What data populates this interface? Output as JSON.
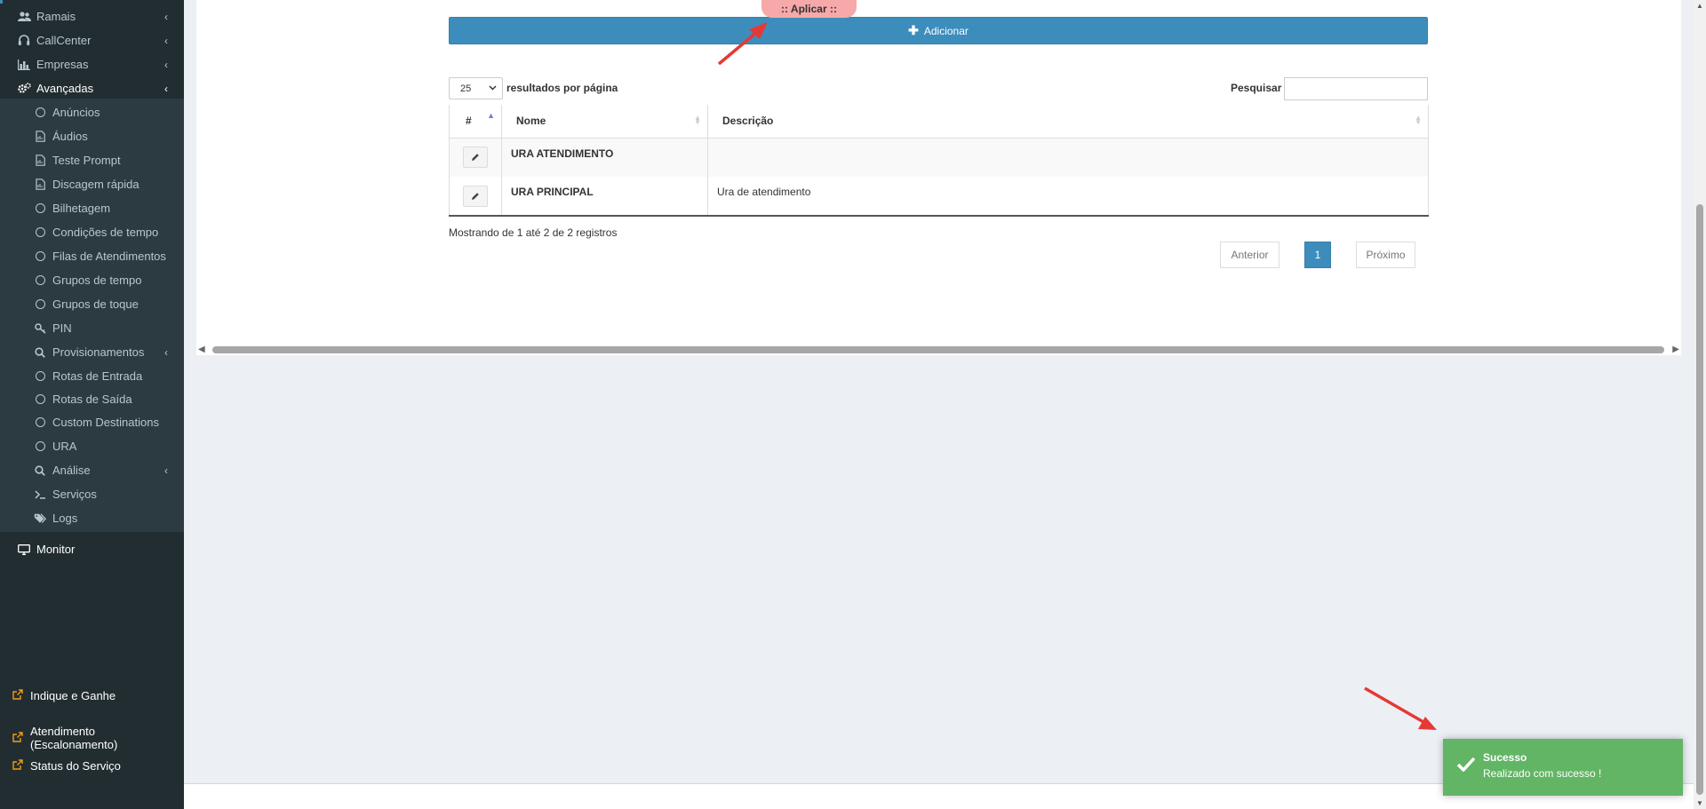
{
  "sidebar": {
    "top_items": [
      {
        "label": "Ramais",
        "icon": "users-icon",
        "chevron": "‹"
      },
      {
        "label": "CallCenter",
        "icon": "headset-icon",
        "chevron": "‹"
      },
      {
        "label": "Empresas",
        "icon": "bar-chart-icon",
        "chevron": "‹"
      },
      {
        "label": "Avançadas",
        "icon": "cogs-icon",
        "chevron": "‹"
      }
    ],
    "sub_items": [
      {
        "label": "Anúncios",
        "icon": "circle-icon"
      },
      {
        "label": "Áudios",
        "icon": "file-audio-icon"
      },
      {
        "label": "Teste Prompt",
        "icon": "file-audio-icon"
      },
      {
        "label": "Discagem rápida",
        "icon": "file-audio-icon"
      },
      {
        "label": "Bilhetagem",
        "icon": "circle-icon"
      },
      {
        "label": "Condições de tempo",
        "icon": "circle-icon"
      },
      {
        "label": "Filas de Atendimentos",
        "icon": "circle-icon"
      },
      {
        "label": "Grupos de tempo",
        "icon": "circle-icon"
      },
      {
        "label": "Grupos de toque",
        "icon": "circle-icon"
      },
      {
        "label": "PIN",
        "icon": "key-icon"
      },
      {
        "label": "Provisionamentos",
        "icon": "search-icon",
        "chevron": "‹"
      },
      {
        "label": "Rotas de Entrada",
        "icon": "circle-icon"
      },
      {
        "label": "Rotas de Saída",
        "icon": "circle-icon"
      },
      {
        "label": "Custom Destinations",
        "icon": "circle-icon"
      },
      {
        "label": "URA",
        "icon": "circle-icon"
      },
      {
        "label": "Análise",
        "icon": "search-icon",
        "chevron": "‹"
      },
      {
        "label": "Serviços",
        "icon": "terminal-icon"
      },
      {
        "label": "Logs",
        "icon": "tags-icon"
      }
    ],
    "monitor": {
      "label": "Monitor",
      "icon": "desktop-icon"
    },
    "bottom_links": [
      {
        "label": "Indique e Ganhe",
        "icon": "external-link-icon"
      },
      {
        "label": "Atendimento (Escalonamento)",
        "icon": "external-link-icon"
      },
      {
        "label": "Status do Serviço",
        "icon": "external-link-icon"
      }
    ]
  },
  "toolbar": {
    "apply_label": ":: Aplicar ::",
    "add_label": "Adicionar"
  },
  "table_controls": {
    "page_length": "25",
    "page_length_label": "resultados por página",
    "search_label": "Pesquisar",
    "search_value": ""
  },
  "table": {
    "columns": [
      "#",
      "Nome",
      "Descrição"
    ],
    "rows": [
      {
        "name": "URA ATENDIMENTO",
        "description": ""
      },
      {
        "name": "URA PRINCIPAL",
        "description": "Ura de atendimento"
      }
    ]
  },
  "pagination": {
    "info": "Mostrando de 1 até 2 de 2 registros",
    "prev_label": "Anterior",
    "current_page": "1",
    "next_label": "Próximo"
  },
  "toast": {
    "title": "Sucesso",
    "message": "Realizado com sucesso !"
  },
  "colors": {
    "sidebar_bg": "#222d32",
    "primary": "#3c8dbc",
    "success": "#62b564",
    "apply_pill": "#f7a8a8",
    "annotation_arrow": "#e53935"
  }
}
